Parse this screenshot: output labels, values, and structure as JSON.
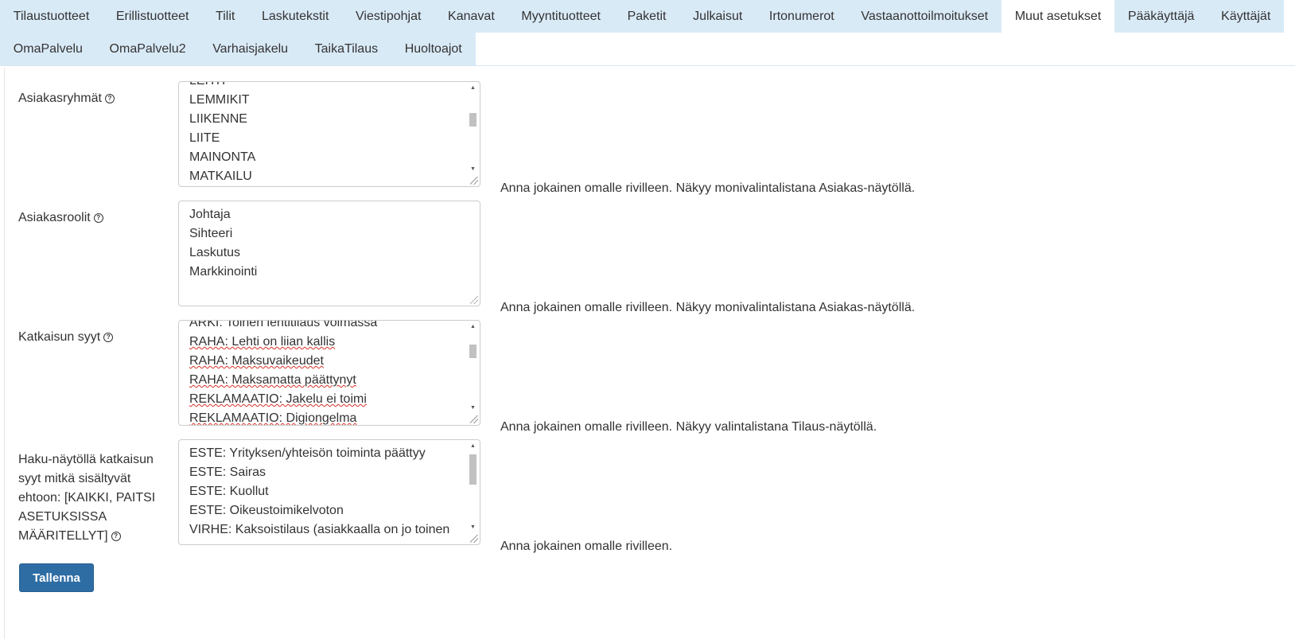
{
  "tabs_row1": [
    "Tilaustuotteet",
    "Erillistuotteet",
    "Tilit",
    "Laskutekstit",
    "Viestipohjat",
    "Kanavat",
    "Myyntituotteet",
    "Paketit",
    "Julkaisut",
    "Irtonumerot",
    "Vastaanottoilmoitukset",
    "Muut asetukset",
    "Pääkäyttäjä",
    "Käyttäjät"
  ],
  "tabs_row2": [
    "OmaPalvelu",
    "OmaPalvelu2",
    "Varhaisjakelu",
    "TaikaTilaus",
    "Huoltoajot"
  ],
  "active_tab": "Muut asetukset",
  "help_icon_glyph": "?",
  "fields": [
    {
      "label": "Asiakasryhmät",
      "lines": [
        "LEHTI",
        "LEMMIKIT",
        "LIIKENNE",
        "LIITE",
        "MAINONTA",
        "MATKAILU"
      ],
      "hint": "Anna jokainen omalle rivilleen. Näkyy monivalintalistana Asiakas-näytöllä."
    },
    {
      "label": "Asiakasroolit",
      "lines": [
        "Johtaja",
        "Sihteeri",
        "Laskutus",
        "Markkinointi"
      ],
      "hint": "Anna jokainen omalle rivilleen. Näkyy monivalintalistana Asiakas-näytöllä."
    },
    {
      "label": "Katkaisun syyt",
      "lines": [
        "ARKI: Toinen lehtitilaus voimassa",
        "RAHA: Lehti on liian kallis",
        "RAHA: Maksuvaikeudet",
        "RAHA: Maksamatta päättynyt",
        "REKLAMAATIO: Jakelu ei toimi",
        "REKLAMAATIO: Digiongelma"
      ],
      "hint": "Anna jokainen omalle rivilleen. Näkyy valintalistana Tilaus-näytöllä."
    },
    {
      "label": "Haku-näytöllä katkaisun syyt mitkä sisältyvät ehtoon: [KAIKKI, PAITSI ASETUKSISSA MÄÄRITELLYT]",
      "lines": [
        "ESTE: Yrityksen/yhteisön toiminta päättyy",
        "ESTE: Sairas",
        "ESTE: Kuollut",
        "ESTE: Oikeustoimikelvoton",
        "VIRHE: Kaksoistilaus (asiakkaalla on jo toinen"
      ],
      "hint": "Anna jokainen omalle rivilleen."
    }
  ],
  "save_label": "Tallenna"
}
